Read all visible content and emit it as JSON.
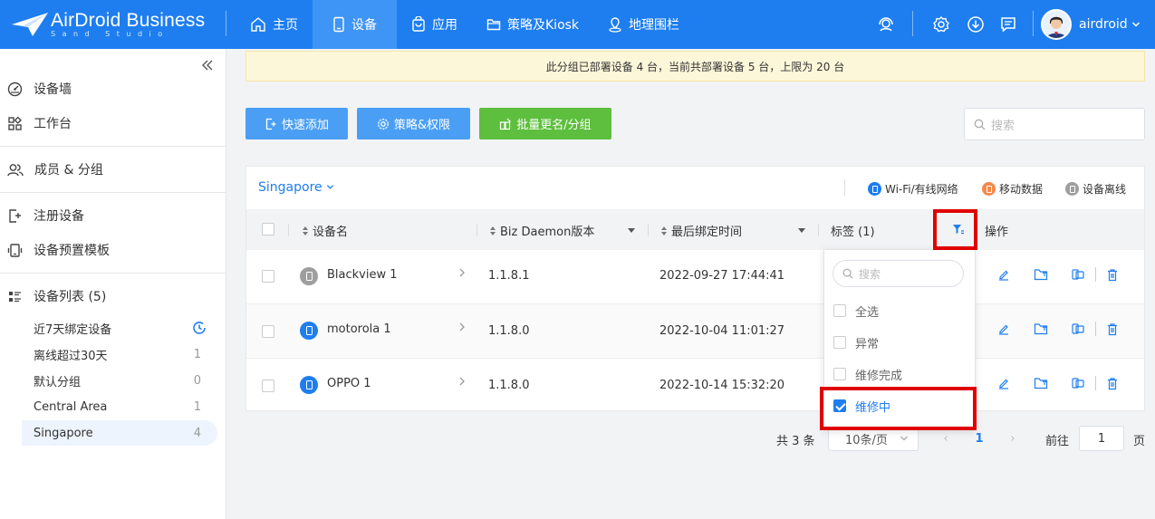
{
  "brand": {
    "title": "AirDroid Business",
    "subtitle": "Sand Studio"
  },
  "nav": [
    {
      "label": "主页",
      "icon": "home-icon"
    },
    {
      "label": "设备",
      "icon": "device-icon",
      "active": true
    },
    {
      "label": "应用",
      "icon": "app-bag-icon"
    },
    {
      "label": "策略及Kiosk",
      "icon": "folder-icon"
    },
    {
      "label": "地理围栏",
      "icon": "geofence-icon"
    }
  ],
  "user": {
    "name": "airdroid"
  },
  "sidebar": {
    "items": [
      {
        "label": "设备墙",
        "icon": "dashboard-icon"
      },
      {
        "label": "工作台",
        "icon": "workbench-icon"
      },
      {
        "label": "成员 & 分组",
        "icon": "members-icon"
      },
      {
        "label": "注册设备",
        "icon": "enroll-icon"
      },
      {
        "label": "设备预置模板",
        "icon": "template-icon"
      },
      {
        "label": "设备列表 (5)",
        "icon": "list-icon"
      }
    ],
    "groups": [
      {
        "label": "近7天绑定设备",
        "count": ""
      },
      {
        "label": "离线超过30天",
        "count": "1"
      },
      {
        "label": "默认分组",
        "count": "0"
      },
      {
        "label": "Central Area",
        "count": "1"
      },
      {
        "label": "Singapore",
        "count": "4",
        "active": true
      }
    ]
  },
  "notice": "此分组已部署设备 4 台，当前共部署设备 5 台，上限为 20 台",
  "toolbar": {
    "quick_add": "快速添加",
    "policy": "策略&权限",
    "batch": "批量更名/分组",
    "search_placeholder": "搜索"
  },
  "panel": {
    "group": "Singapore",
    "legend": [
      {
        "label": "Wi-Fi/有线网络",
        "color": "#1e7ef0"
      },
      {
        "label": "移动数据",
        "color": "#f5894a"
      },
      {
        "label": "设备离线",
        "color": "#9e9e9e"
      }
    ]
  },
  "table": {
    "columns": [
      "设备名",
      "Biz Daemon版本",
      "最后绑定时间",
      "标签 (1)",
      "操作"
    ],
    "rows": [
      {
        "name": "Blackview 1",
        "version": "1.1.8.1",
        "time": "2022-09-27 17:44:41",
        "status": "offline",
        "color": "#9e9e9e"
      },
      {
        "name": "motorola 1",
        "version": "1.1.8.0",
        "time": "2022-10-04 11:01:27",
        "status": "wifi",
        "color": "#1e7ef0"
      },
      {
        "name": "OPPO 1",
        "version": "1.1.8.0",
        "time": "2022-10-14 15:32:20",
        "status": "wifi",
        "color": "#1e7ef0"
      }
    ]
  },
  "filter": {
    "search_placeholder": "搜索",
    "options": [
      {
        "label": "全选",
        "checked": false
      },
      {
        "label": "异常",
        "checked": false
      },
      {
        "label": "维修完成",
        "checked": false
      },
      {
        "label": "维修中",
        "checked": true
      }
    ]
  },
  "pager": {
    "total": "共 3 条",
    "page_size": "10条/页",
    "current": "1",
    "goto_label": "前往",
    "goto_value": "1",
    "page_suffix": "页"
  }
}
